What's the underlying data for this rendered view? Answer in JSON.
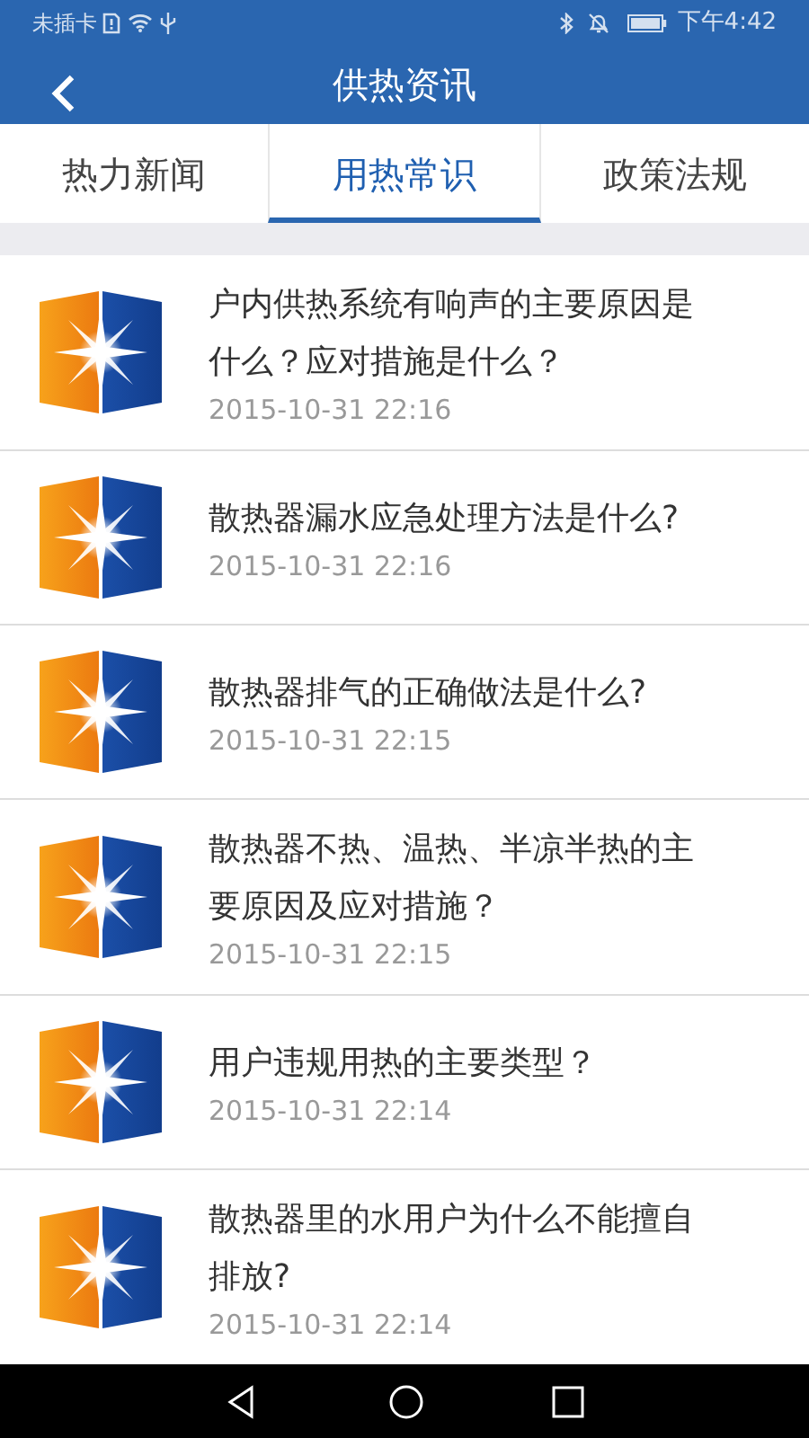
{
  "status_bar": {
    "carrier": "未插卡",
    "time": "下午4:42"
  },
  "header": {
    "title": "供热资讯"
  },
  "tabs": [
    {
      "label": "热力新闻",
      "selected": false
    },
    {
      "label": "用热常识",
      "selected": true
    },
    {
      "label": "政策法规",
      "selected": false
    }
  ],
  "articles": [
    {
      "title": "户内供热系统有响声的主要原因是什么？应对措施是什么？",
      "date": "2015-10-31 22:16"
    },
    {
      "title": "散热器漏水应急处理方法是什么?",
      "date": "2015-10-31 22:16"
    },
    {
      "title": "散热器排气的正确做法是什么?",
      "date": "2015-10-31 22:15"
    },
    {
      "title": "散热器不热、温热、半凉半热的主要原因及应对措施？",
      "date": "2015-10-31 22:15"
    },
    {
      "title": "用户违规用热的主要类型？",
      "date": "2015-10-31 22:14"
    },
    {
      "title": "散热器里的水用户为什么不能擅自排放?",
      "date": "2015-10-31 22:14"
    }
  ]
}
